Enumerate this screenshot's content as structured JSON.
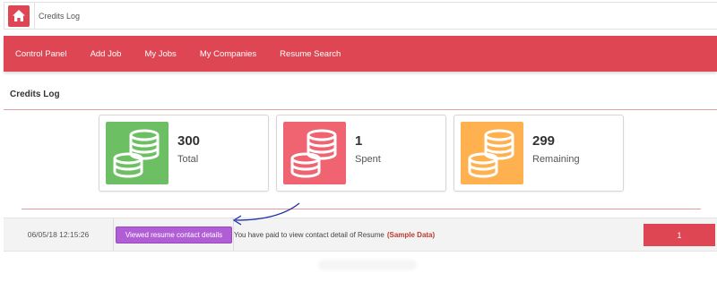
{
  "topbar": {
    "title": "Credits Log",
    "home_icon": "home-icon"
  },
  "nav": {
    "items": [
      "Control Panel",
      "Add Job",
      "My Jobs",
      "My Companies",
      "Resume Search"
    ]
  },
  "section": {
    "title": "Credits Log"
  },
  "stats": [
    {
      "value": "300",
      "label": "Total",
      "color": "#6cbf63",
      "icon": "coins-icon"
    },
    {
      "value": "1",
      "label": "Spent",
      "color": "#f06370",
      "icon": "coins-icon"
    },
    {
      "value": "299",
      "label": "Remaining",
      "color": "#ffb04f",
      "icon": "coins-icon"
    }
  ],
  "log": [
    {
      "date": "06/05/18 12:15:26",
      "badge": "Viewed resume contact details",
      "description": "You have paid to view contact detail of Resume",
      "sample_open": "(",
      "sample_text": "Sample Data",
      "sample_close": ")",
      "credits": "1"
    }
  ],
  "colors": {
    "brand": "#df4654",
    "badge": "#b15dd6",
    "annotation": "#1f2fa8"
  }
}
